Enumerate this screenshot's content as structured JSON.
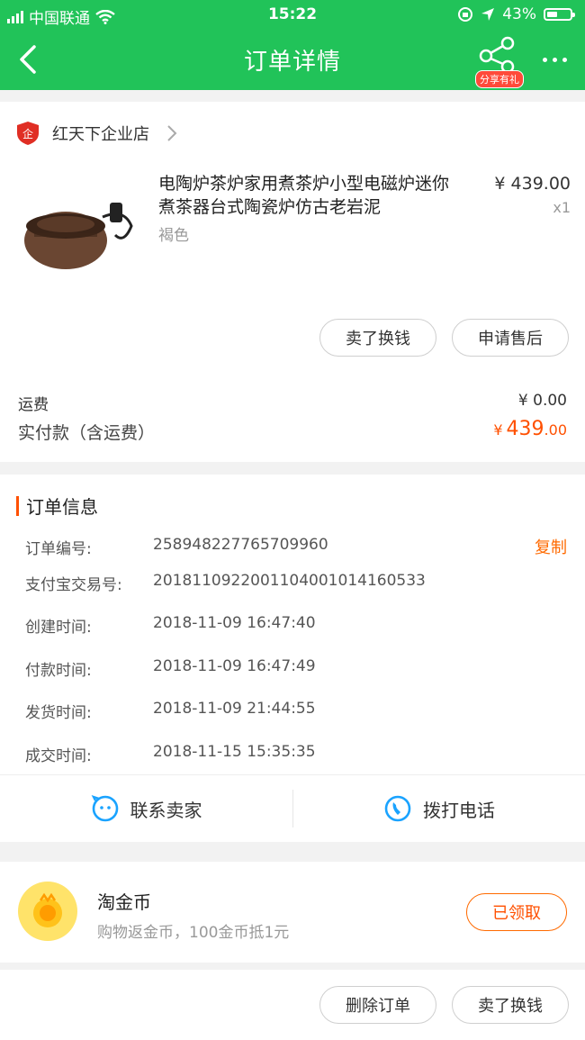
{
  "status_bar": {
    "carrier": "中国联通",
    "time": "15:22",
    "battery": "43%"
  },
  "nav": {
    "title": "订单详情",
    "share_tag": "分享有礼"
  },
  "shop": {
    "name": "红天下企业店"
  },
  "product": {
    "title_line1": "电陶炉茶炉家用煮茶炉小型电磁炉迷你",
    "title_line2": "煮茶器台式陶瓷炉仿古老岩泥",
    "variant": "褐色",
    "price": "¥ 439.00",
    "qty": "x1"
  },
  "actions": {
    "sell_label": "卖了换钱",
    "after_sale_label": "申请售后"
  },
  "fees": {
    "shipping_label": "运费",
    "shipping_value": "¥ 0.00",
    "paid_label": "实付款（含运费）",
    "paid_currency": "¥",
    "paid_int": "439",
    "paid_dec": ".00"
  },
  "order_info": {
    "heading": "订单信息",
    "copy_label": "复制",
    "rows": [
      {
        "label": "订单编号:",
        "value": "258948227765709960"
      },
      {
        "label": "支付宝交易号:",
        "value": "2018110922001104001014160533"
      },
      {
        "label": "创建时间:",
        "value": "2018-11-09 16:47:40"
      },
      {
        "label": "付款时间:",
        "value": "2018-11-09 16:47:49"
      },
      {
        "label": "发货时间:",
        "value": "2018-11-09 21:44:55"
      },
      {
        "label": "成交时间:",
        "value": "2018-11-15 15:35:35"
      }
    ]
  },
  "contact": {
    "seller_label": "联系卖家",
    "call_label": "拨打电话"
  },
  "coins": {
    "title": "淘金币",
    "desc": "购物返金币，100金币抵1元",
    "button": "已领取"
  },
  "bottom": {
    "delete_label": "删除订单",
    "sell_label": "卖了换钱"
  },
  "colors": {
    "green": "#21c359",
    "orange": "#ff5000"
  }
}
